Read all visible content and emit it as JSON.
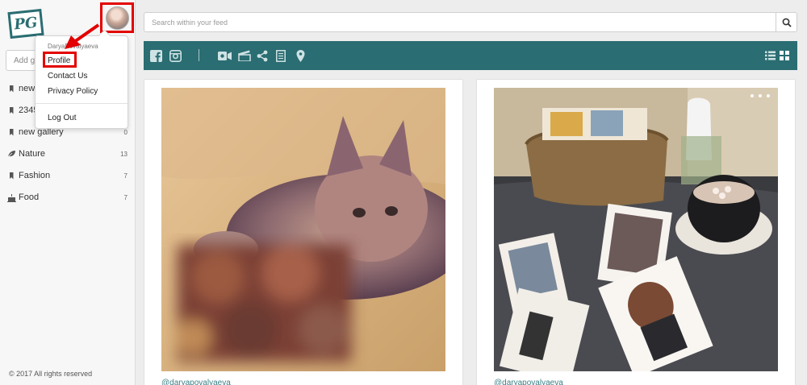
{
  "app": {
    "logo_text": "PG",
    "copyright": "© 2017 All rights reserved"
  },
  "user_menu": {
    "username": "DaryaPovalyaeva",
    "items": [
      {
        "label": "Profile",
        "highlighted": true
      },
      {
        "label": "Contact Us"
      },
      {
        "label": "Privacy Policy"
      },
      {
        "label": "Log Out"
      }
    ]
  },
  "sidebar": {
    "add_placeholder": "Add gallery",
    "galleries": [
      {
        "label": "new",
        "count": "",
        "icon": "bookmark-icon"
      },
      {
        "label": "2345",
        "count": "",
        "icon": "bookmark-icon"
      },
      {
        "label": "new gallery",
        "count": "0",
        "icon": "bookmark-icon"
      },
      {
        "label": "Nature",
        "count": "13",
        "icon": "leaf-icon"
      },
      {
        "label": "Fashion",
        "count": "7",
        "icon": "bookmark-icon"
      },
      {
        "label": "Food",
        "count": "7",
        "icon": "cake-icon"
      }
    ]
  },
  "search": {
    "placeholder": "Search within your feed",
    "icon": "search-icon"
  },
  "toolbar": {
    "color": "#2a6d72",
    "left_icons": [
      "facebook-icon",
      "instagram-icon",
      "video-icon",
      "clapperboard-icon",
      "share-icon",
      "document-icon",
      "location-pin-icon"
    ],
    "right_icons": [
      "list-view-icon",
      "grid-view-icon"
    ]
  },
  "feed": {
    "cards": [
      {
        "owner": "@daryapovalyaeva",
        "image": "fluffy cat lying next to blurred objects"
      },
      {
        "owner": "@daryapovalyaeva",
        "image": "wicker basket, cat mug with marshmallows and illustrated cards on a table"
      }
    ]
  },
  "colors": {
    "accent": "#2a6d72",
    "highlight": "#e30000"
  }
}
